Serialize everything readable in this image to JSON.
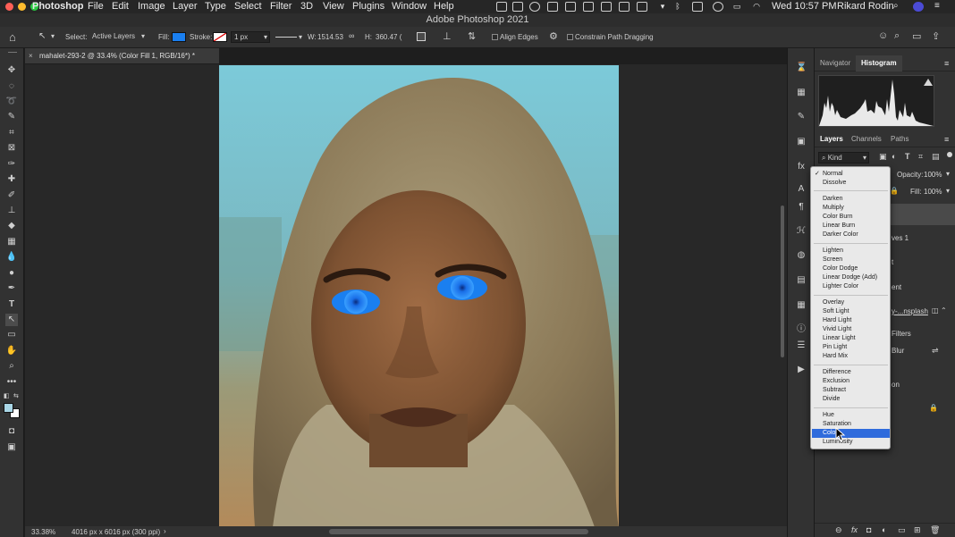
{
  "menubar": {
    "app": "Photoshop",
    "items": [
      "File",
      "Edit",
      "Image",
      "Layer",
      "Type",
      "Select",
      "Filter",
      "3D",
      "View",
      "Plugins",
      "Window",
      "Help"
    ],
    "clock": "Wed 10:57 PM",
    "user": "Rikard Rodin"
  },
  "window": {
    "title": "Adobe Photoshop 2021"
  },
  "options": {
    "select_label": "Select:",
    "select_value": "Active Layers",
    "fill_label": "Fill:",
    "fill_color": "#1a7ff0",
    "stroke_label": "Stroke:",
    "stroke_width": "1 px",
    "w_label": "W:",
    "w_value": "1514.53",
    "h_label": "H:",
    "h_value": "360.47 (",
    "align_edges": "Align Edges",
    "constrain": "Constrain Path Dragging"
  },
  "document": {
    "tab_title": "mahalet-293-2 @ 33.4% (Color Fill 1, RGB/16*) *",
    "zoom": "33.38%",
    "info": "4016 px x 6016 px (300 ppi)"
  },
  "panels": {
    "top_tabs": [
      "Navigator",
      "Histogram"
    ],
    "layer_tabs": [
      "Layers",
      "Channels",
      "Paths"
    ],
    "kind_label": "Kind",
    "opacity_label": "Opacity:",
    "opacity_value": "100%",
    "fill_label": "Fill:",
    "fill_value": "100%",
    "peek": [
      "ves 1",
      "t",
      "ent",
      "y-...nsplash",
      "Filters",
      "Blur",
      "on"
    ]
  },
  "blend_modes": {
    "groups": [
      [
        "Normal",
        "Dissolve"
      ],
      [
        "Darken",
        "Multiply",
        "Color Burn",
        "Linear Burn",
        "Darker Color"
      ],
      [
        "Lighten",
        "Screen",
        "Color Dodge",
        "Linear Dodge (Add)",
        "Lighter Color"
      ],
      [
        "Overlay",
        "Soft Light",
        "Hard Light",
        "Vivid Light",
        "Linear Light",
        "Pin Light",
        "Hard Mix"
      ],
      [
        "Difference",
        "Exclusion",
        "Subtract",
        "Divide"
      ],
      [
        "Hue",
        "Saturation",
        "Color",
        "Luminosity"
      ]
    ],
    "checked": "Normal",
    "highlighted": "Color"
  },
  "colors": {
    "accent": "#2f6bdc",
    "eye_fill": "#1a7ff0"
  }
}
